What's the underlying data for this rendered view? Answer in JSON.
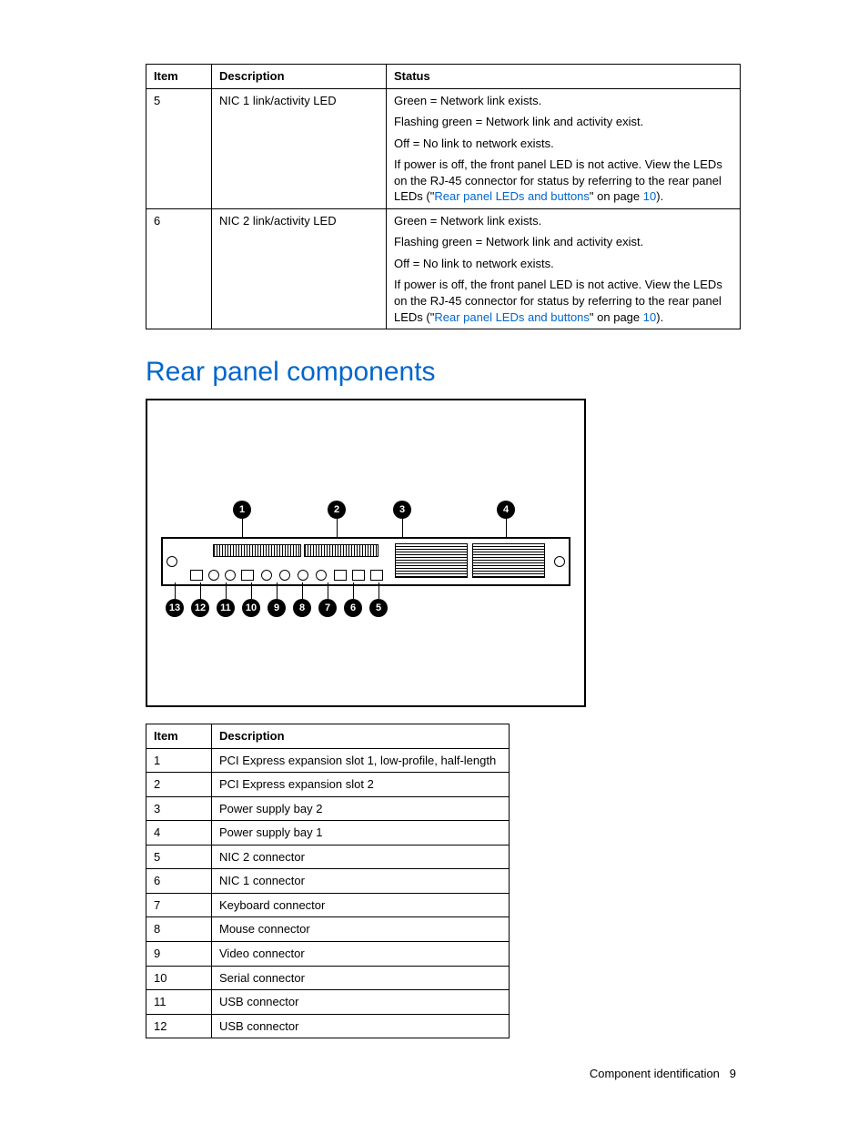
{
  "table1": {
    "headers": [
      "Item",
      "Description",
      "Status"
    ],
    "rows": [
      {
        "item": "5",
        "desc": "NIC 1 link/activity LED",
        "status": {
          "p1": "Green = Network link exists.",
          "p2": "Flashing green = Network link and activity exist.",
          "p3": "Off = No link to network exists.",
          "p4a": "If power is off, the front panel LED is not active. View the LEDs on the RJ-45 connector for status by referring to the rear panel LEDs (\"",
          "p4link": "Rear panel LEDs and buttons",
          "p4b": "\" on page ",
          "p4page": "10",
          "p4c": ")."
        }
      },
      {
        "item": "6",
        "desc": "NIC 2 link/activity LED",
        "status": {
          "p1": "Green = Network link exists.",
          "p2": "Flashing green = Network link and activity exist.",
          "p3": "Off = No link to network exists.",
          "p4a": "If power is off, the front panel LED is not active. View the LEDs on the RJ-45 connector for status by referring to the rear panel LEDs (\"",
          "p4link": "Rear panel LEDs and buttons",
          "p4b": "\" on page ",
          "p4page": "10",
          "p4c": ")."
        }
      }
    ]
  },
  "section_heading": "Rear panel components",
  "callouts_top": [
    "1",
    "2",
    "3",
    "4"
  ],
  "callouts_bot": [
    "13",
    "12",
    "11",
    "10",
    "9",
    "8",
    "7",
    "6",
    "5"
  ],
  "table2": {
    "headers": [
      "Item",
      "Description"
    ],
    "rows": [
      {
        "item": "1",
        "desc": "PCI Express expansion slot 1, low-profile, half-length"
      },
      {
        "item": "2",
        "desc": "PCI Express expansion slot 2"
      },
      {
        "item": "3",
        "desc": "Power supply bay 2"
      },
      {
        "item": "4",
        "desc": "Power supply bay 1"
      },
      {
        "item": "5",
        "desc": "NIC 2 connector"
      },
      {
        "item": "6",
        "desc": "NIC 1 connector"
      },
      {
        "item": "7",
        "desc": "Keyboard connector"
      },
      {
        "item": "8",
        "desc": "Mouse connector"
      },
      {
        "item": "9",
        "desc": "Video connector"
      },
      {
        "item": "10",
        "desc": "Serial connector"
      },
      {
        "item": "11",
        "desc": "USB connector"
      },
      {
        "item": "12",
        "desc": "USB connector"
      }
    ]
  },
  "footer": {
    "section": "Component identification",
    "page": "9"
  }
}
